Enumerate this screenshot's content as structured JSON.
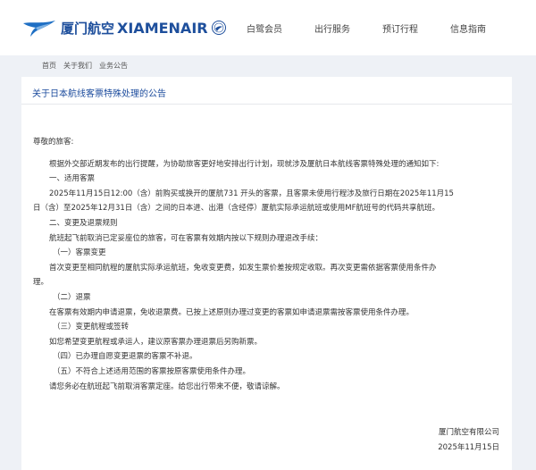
{
  "header": {
    "logo_cn": "厦门航空",
    "logo_en": "XIAMENAIR",
    "nav": [
      "白鹭会员",
      "出行服务",
      "预订行程",
      "信息指南"
    ]
  },
  "breadcrumb": [
    "首页",
    "关于我们",
    "业务公告"
  ],
  "notice": {
    "title": "关于日本航线客票特殊处理的公告",
    "greeting": "尊敬的旅客:",
    "lines": [
      "根据外交部近期发布的出行提醒，为协助旅客更好地安排出行计划，现就涉及厦航日本航线客票特殊处理的通知如下:",
      "一、适用客票",
      "2025年11月15日12:00（含）前购买或换开的厦航731 开头的客票，且客票未使用行程涉及旅行日期在2025年11月15",
      "日（含）至2025年12月31日（含）之间的日本进、出港（含经停）厦航实际承运航班或使用MF航班号的代码共享航班。",
      "二、变更及退票规则",
      "航班起飞前取消已定妥座位的旅客，可在客票有效期内按以下规则办理退改手续：",
      "（一）客票变更",
      "首次变更至相同航程的厦航实际承运航班，免收变更费，如发生票价差按规定收取。再次变更需依据客票使用条件办",
      "理。",
      "（二）退票",
      "在客票有效期内申请退票，免收退票费。已按上述原则办理过变更的客票如申请退票需按客票使用条件办理。",
      "（三）变更航程或签转",
      "如您希望变更航程或承运人，建议原客票办理退票后另购新票。",
      "（四）已办理自愿变更退票的客票不补退。",
      "（五）不符合上述适用范围的客票按原客票使用条件办理。",
      "请您务必在航班起飞前取消客票定座。给您出行带来不便，敬请谅解。"
    ],
    "signature": "厦门航空有限公司",
    "date": "2025年11月15日"
  },
  "colors": {
    "brand": "#1e4f9c",
    "title": "#1a4a9c",
    "background": "#eef1f6"
  },
  "icons": {
    "logo": "egret-logo-icon",
    "seal": "xiamenair-seal-icon"
  }
}
